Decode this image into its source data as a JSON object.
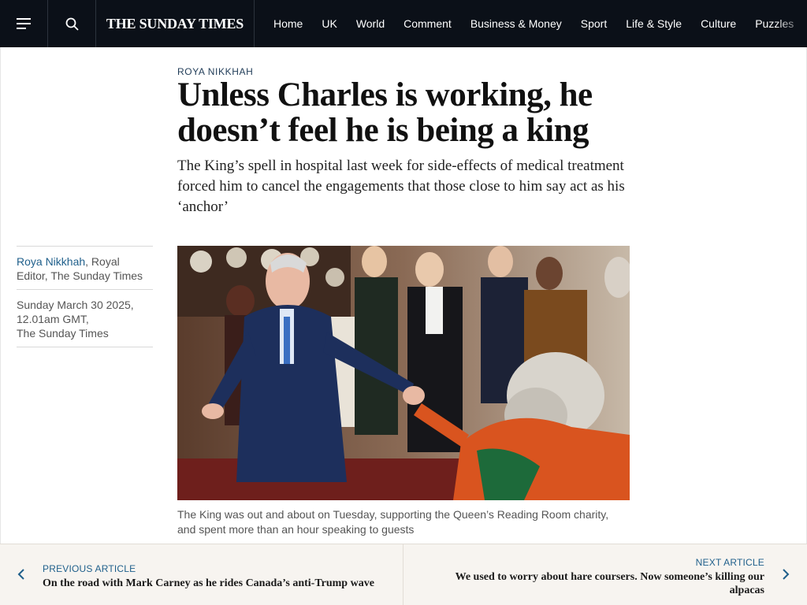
{
  "header": {
    "logo": "THE SUNDAY TIMES",
    "menu_icon": "hamburger-menu-icon",
    "search_icon": "search-icon",
    "nav": [
      "Home",
      "UK",
      "World",
      "Comment",
      "Business & Money",
      "Sport",
      "Life & Style",
      "Culture",
      "Puzzles"
    ]
  },
  "article": {
    "kicker": "ROYA NIKKHAH",
    "headline": "Unless Charles is working, he doesn’t feel he is being a king",
    "standfirst": "The King’s spell in hospital last week for side-effects of medical treatment forced him to cancel the engagements that those close to him say act as his ‘anchor’",
    "byline": {
      "author": "Roya Nikkhah",
      "role": ", Royal Editor, The Sunday Times",
      "date_line1": "Sunday March 30 2025,",
      "date_line2": "12.01am GMT,",
      "date_line3": "The Sunday Times"
    },
    "caption": "The King was out and about on Tuesday, supporting the Queen’s Reading Room charity, and spent more than an hour speaking to guests"
  },
  "bottom_nav": {
    "prev_label": "PREVIOUS ARTICLE",
    "prev_title": "On the road with Mark Carney as he rides Canada’s anti-Trump wave",
    "next_label": "NEXT ARTICLE",
    "next_title": "We used to worry about hare coursers. Now someone’s killing our alpacas"
  },
  "colors": {
    "header_bg": "#0b1018",
    "link_blue": "#1f5f8b",
    "bottom_bg": "#f7f4f0"
  }
}
